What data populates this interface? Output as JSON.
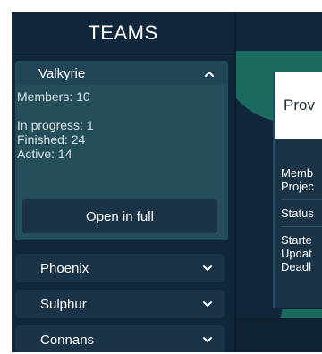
{
  "sidebar": {
    "title": "TEAMS",
    "expanded_team": {
      "name": "Valkyrie",
      "members": "Members: 10",
      "in_progress": "In progress: 1",
      "finished": "Finished: 24",
      "active": "Active: 14",
      "open_button": "Open in full"
    },
    "teams": [
      {
        "name": "Phoenix"
      },
      {
        "name": "Sulphur"
      },
      {
        "name": "Connans"
      }
    ]
  },
  "main": {
    "card": {
      "title": "Prov",
      "rows": [
        "Memb",
        "Projec",
        "Status",
        "Starte",
        "Updat",
        "Deadl"
      ]
    }
  }
}
